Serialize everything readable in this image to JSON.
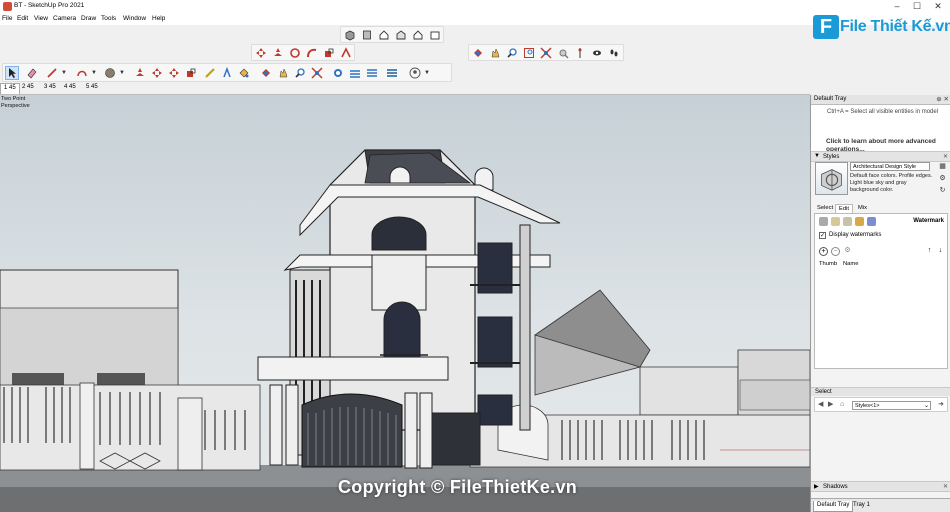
{
  "window": {
    "title": "BT - SketchUp Pro 2021",
    "controls": {
      "minimize": "–",
      "maximize": "☐",
      "close": "✕"
    }
  },
  "menu": [
    "File",
    "Edit",
    "View",
    "Camera",
    "Draw",
    "Tools",
    "Window",
    "Help"
  ],
  "toolbars": {
    "views": [
      "iso-view-icon",
      "top-view-icon",
      "front-view-icon",
      "right-view-icon",
      "back-view-icon",
      "left-view-icon"
    ],
    "edit_tools": [
      "move-icon",
      "push-pull-icon",
      "rotate-icon",
      "follow-me-icon",
      "scale-icon",
      "offset-icon"
    ],
    "camera": [
      "orbit-icon",
      "pan-icon",
      "zoom-icon",
      "zoom-window-icon",
      "zoom-extents-icon",
      "position-camera-icon",
      "look-around-icon",
      "walk-icon",
      "footprints-icon"
    ],
    "main": [
      "select-icon",
      "eraser-icon",
      "line-icon",
      "arc-icon",
      "shape-icon",
      "push-pull-icon",
      "move-icon",
      "rotate-icon",
      "scale-icon",
      "tape-measure-icon",
      "text-icon",
      "paint-bucket-icon",
      "orbit-icon",
      "pan-icon",
      "zoom-icon",
      "zoom-extents-icon",
      "warehouse-icon",
      "extension-icon",
      "layout-icon",
      "section-icon",
      "account-icon"
    ]
  },
  "scene_tabs": [
    "1 45",
    "2 45",
    "3 45",
    "4 45",
    "5 45"
  ],
  "selected_scene": "1 45",
  "viewport": {
    "view_label_1": "Two Point",
    "view_label_2": "Perspective",
    "watermark": "Copyright © FileThietKe.vn"
  },
  "logo": {
    "letter": "F",
    "text": "File Thiết Kế.vn"
  },
  "tray": {
    "title": "Default Tray",
    "instructor_line1": "Ctrl+A = Select all visible entities in model",
    "instructor_line2": "Click to learn about more advanced operations...",
    "styles_panel": {
      "title": "Styles",
      "style_name": "Architectural Design Style",
      "style_description": "Default face colors. Profile edges. Light blue sky and gray background color.",
      "tabs": [
        "Select",
        "Edit",
        "Mix"
      ],
      "selected_tab": "Edit",
      "watermark_header": "Watermark",
      "display_watermarks_label": "Display watermarks",
      "display_watermarks_checked": true,
      "columns": [
        "Thumb",
        "Name"
      ]
    },
    "select_panel": {
      "title": "Select",
      "dropdown_value": "Styles<1>"
    },
    "shadows_panel": {
      "title": "Shadows"
    },
    "tray_tabs": [
      "Default Tray",
      "Tray 1"
    ],
    "selected_tray_tab": "Default Tray"
  }
}
